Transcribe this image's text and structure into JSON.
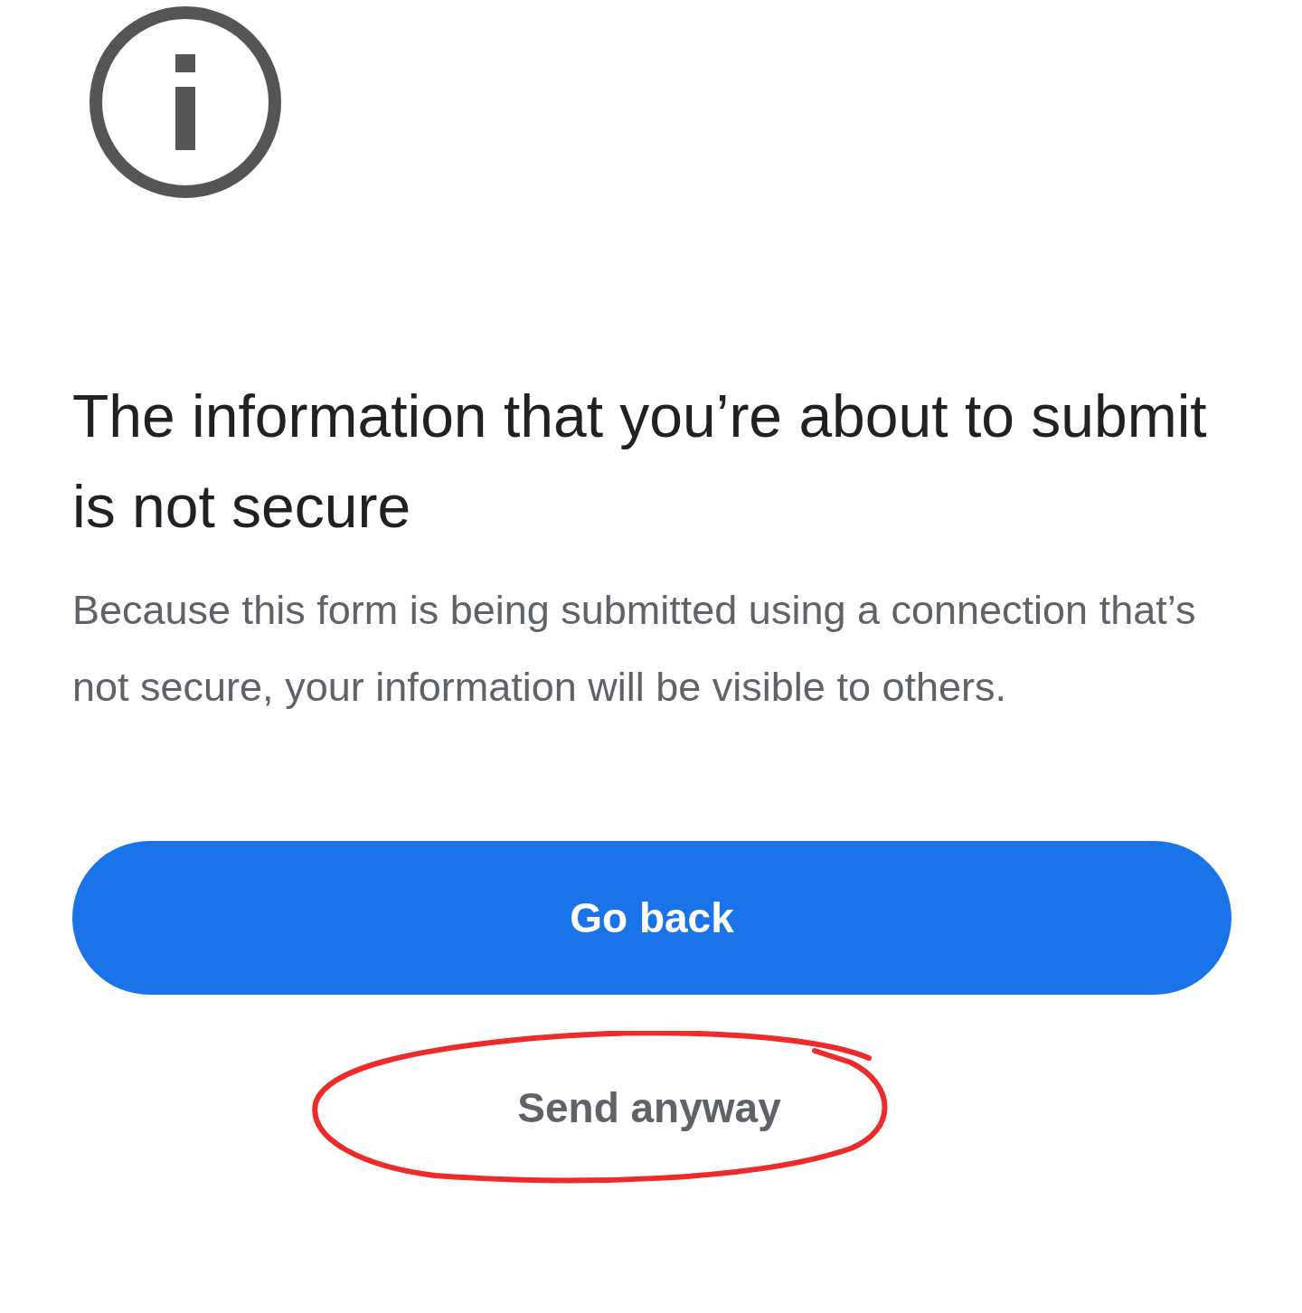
{
  "title": "The information that you’re about to submit is not secure",
  "message": "Because this form is being submitted using a connection that’s not secure, your information will be visible to others.",
  "primary_button": "Go back",
  "secondary_button": {
    "label": "Send anyway",
    "circled": true
  }
}
